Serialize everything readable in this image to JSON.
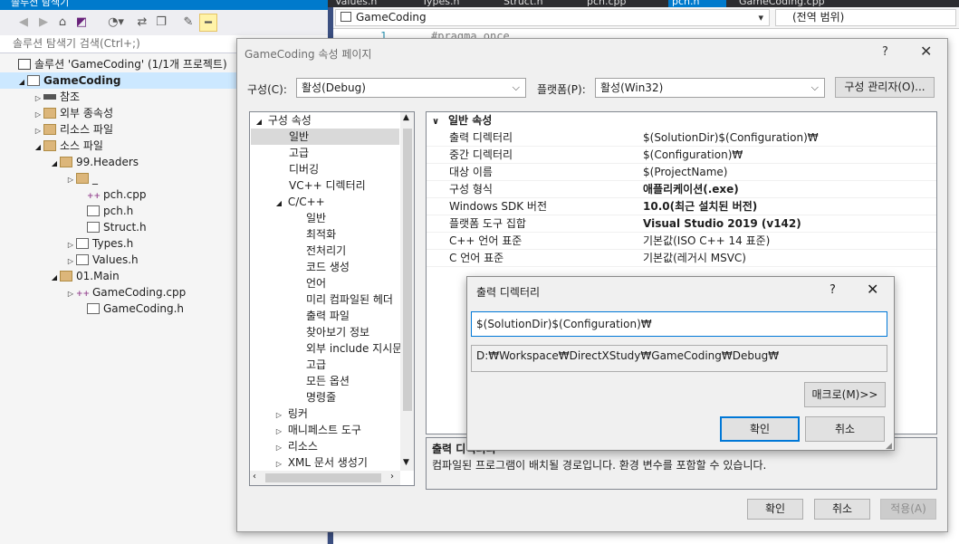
{
  "solution_explorer": {
    "title": "솔루션 탐색기",
    "search_placeholder": "솔루션 탐색기 검색(Ctrl+;)",
    "tree": [
      {
        "label": "솔루션 'GameCoding' (1/1개 프로젝트)"
      },
      {
        "label": "GameCoding"
      },
      {
        "label": "참조"
      },
      {
        "label": "외부 종속성"
      },
      {
        "label": "리소스 파일"
      },
      {
        "label": "소스 파일"
      },
      {
        "label": "99.Headers"
      },
      {
        "label": "_"
      },
      {
        "label": "pch.cpp"
      },
      {
        "label": "pch.h"
      },
      {
        "label": "Struct.h"
      },
      {
        "label": "Types.h"
      },
      {
        "label": "Values.h"
      },
      {
        "label": "01.Main"
      },
      {
        "label": "GameCoding.cpp"
      },
      {
        "label": "GameCoding.h"
      }
    ],
    "toolbar_icons": [
      "back-icon",
      "forward-icon",
      "home-icon",
      "vs-icon",
      "history-icon",
      "sync-icon",
      "copy-icon",
      "wrench-icon",
      "minus-icon"
    ]
  },
  "editor": {
    "tabs": [
      "Values.h",
      "Types.h",
      "Struct.h",
      "pch.cpp",
      "pch.h",
      "GameCoding.cpp"
    ],
    "nav_file": "GameCoding",
    "nav_scope": "(전역 범위)",
    "line_number": "1",
    "code": "#pragma once"
  },
  "property_pages": {
    "title": "GameCoding 속성 페이지",
    "help": "?",
    "close": "✕",
    "config_label": "구성(C):",
    "config_value": "활성(Debug)",
    "platform_label": "플랫폼(P):",
    "platform_value": "활성(Win32)",
    "config_manager": "구성 관리자(O)...",
    "tree": [
      {
        "label": "구성 속성"
      },
      {
        "label": "일반"
      },
      {
        "label": "고급"
      },
      {
        "label": "디버깅"
      },
      {
        "label": "VC++ 디렉터리"
      },
      {
        "label": "C/C++"
      },
      {
        "label": "일반"
      },
      {
        "label": "최적화"
      },
      {
        "label": "전처리기"
      },
      {
        "label": "코드 생성"
      },
      {
        "label": "언어"
      },
      {
        "label": "미리 컴파일된 헤더"
      },
      {
        "label": "출력 파일"
      },
      {
        "label": "찾아보기 정보"
      },
      {
        "label": "외부 include 지시문"
      },
      {
        "label": "고급"
      },
      {
        "label": "모든 옵션"
      },
      {
        "label": "명령줄"
      },
      {
        "label": "링커"
      },
      {
        "label": "매니페스트 도구"
      },
      {
        "label": "리소스"
      },
      {
        "label": "XML 문서 생성기"
      }
    ],
    "grid_header": "일반 속성",
    "grid": [
      {
        "name": "출력 디렉터리",
        "value": "$(SolutionDir)$(Configuration)₩"
      },
      {
        "name": "중간 디렉터리",
        "value": "$(Configuration)₩"
      },
      {
        "name": "대상 이름",
        "value": "$(ProjectName)"
      },
      {
        "name": "구성 형식",
        "value": "애플리케이션(.exe)"
      },
      {
        "name": "Windows SDK 버전",
        "value": "10.0(최근 설치된 버전)"
      },
      {
        "name": "플랫폼 도구 집합",
        "value": "Visual Studio 2019 (v142)"
      },
      {
        "name": "C++ 언어 표준",
        "value": "기본값(ISO C++ 14 표준)"
      },
      {
        "name": "C 언어 표준",
        "value": "기본값(레거시 MSVC)"
      }
    ],
    "desc_title": "출력 디렉터리",
    "desc_text": "컴파일된 프로그램이 배치될 경로입니다. 환경 변수를 포함할 수 있습니다.",
    "ok": "확인",
    "cancel": "취소",
    "apply": "적용(A)"
  },
  "output_dir_dialog": {
    "title": "출력 디렉터리",
    "help": "?",
    "close": "✕",
    "value": "$(SolutionDir)$(Configuration)₩",
    "evaluated": "D:₩Workspace₩DirectXStudy₩GameCoding₩Debug₩",
    "macros": "매크로(M)>>",
    "ok": "확인",
    "cancel": "취소"
  },
  "colors": {
    "accent": "#007acc",
    "selection": "#cce8ff",
    "dialog_bg": "#f0f0f0"
  }
}
